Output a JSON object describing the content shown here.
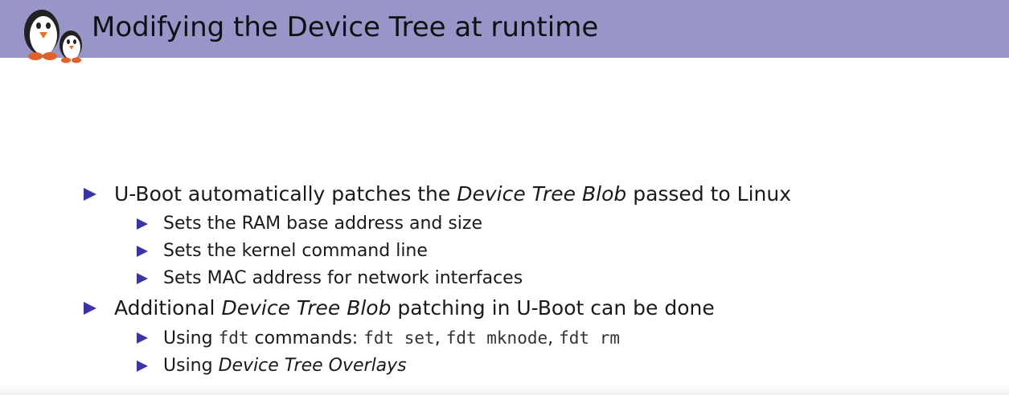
{
  "slide": {
    "title": "Modifying the Device Tree at runtime",
    "logo_icon": "penguins-logo",
    "accent_color": "#3a34a6",
    "header_color": "#9896c9"
  },
  "bullets": [
    {
      "pre": "U-Boot automatically patches the ",
      "em": "Device Tree Blob",
      "post": " passed to Linux",
      "subs": [
        "Sets the RAM base address and size",
        "Sets the kernel command line",
        "Sets MAC address for network interfaces"
      ]
    },
    {
      "pre": "Additional ",
      "em": "Device Tree Blob",
      "post": " patching in U-Boot can be done",
      "sub1": {
        "t1": "Using ",
        "c1": "fdt",
        "t2": " commands: ",
        "c2": "fdt set",
        "t3": ", ",
        "c3": "fdt mknode",
        "t4": ", ",
        "c4": "fdt rm"
      },
      "sub2": {
        "pre": "Using ",
        "em": "Device Tree Overlays"
      }
    }
  ]
}
